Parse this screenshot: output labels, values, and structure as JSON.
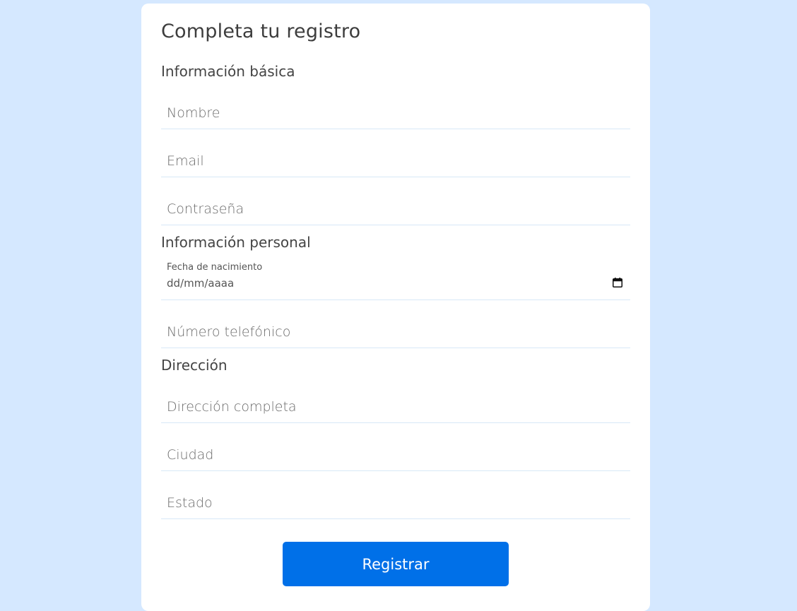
{
  "form": {
    "title": "Completa tu registro",
    "submit_label": "Registrar"
  },
  "sections": {
    "basic": {
      "heading": "Información básica",
      "name_placeholder": "Nombre",
      "email_placeholder": "Email",
      "password_placeholder": "Contraseña"
    },
    "personal": {
      "heading": "Información personal",
      "birthdate_label": "Fecha de nacimiento",
      "birthdate_placeholder": "dd/mm/aaaa",
      "phone_placeholder": "Número telefónico"
    },
    "address": {
      "heading": "Dirección",
      "full_address_placeholder": "Dirección completa",
      "city_placeholder": "Ciudad",
      "state_placeholder": "Estado"
    }
  },
  "icons": {
    "date_picker": "calendar-icon"
  },
  "colors": {
    "background": "#d5e8ff",
    "card": "#ffffff",
    "accent": "#0070e8",
    "divider": "#d7e8f7"
  }
}
